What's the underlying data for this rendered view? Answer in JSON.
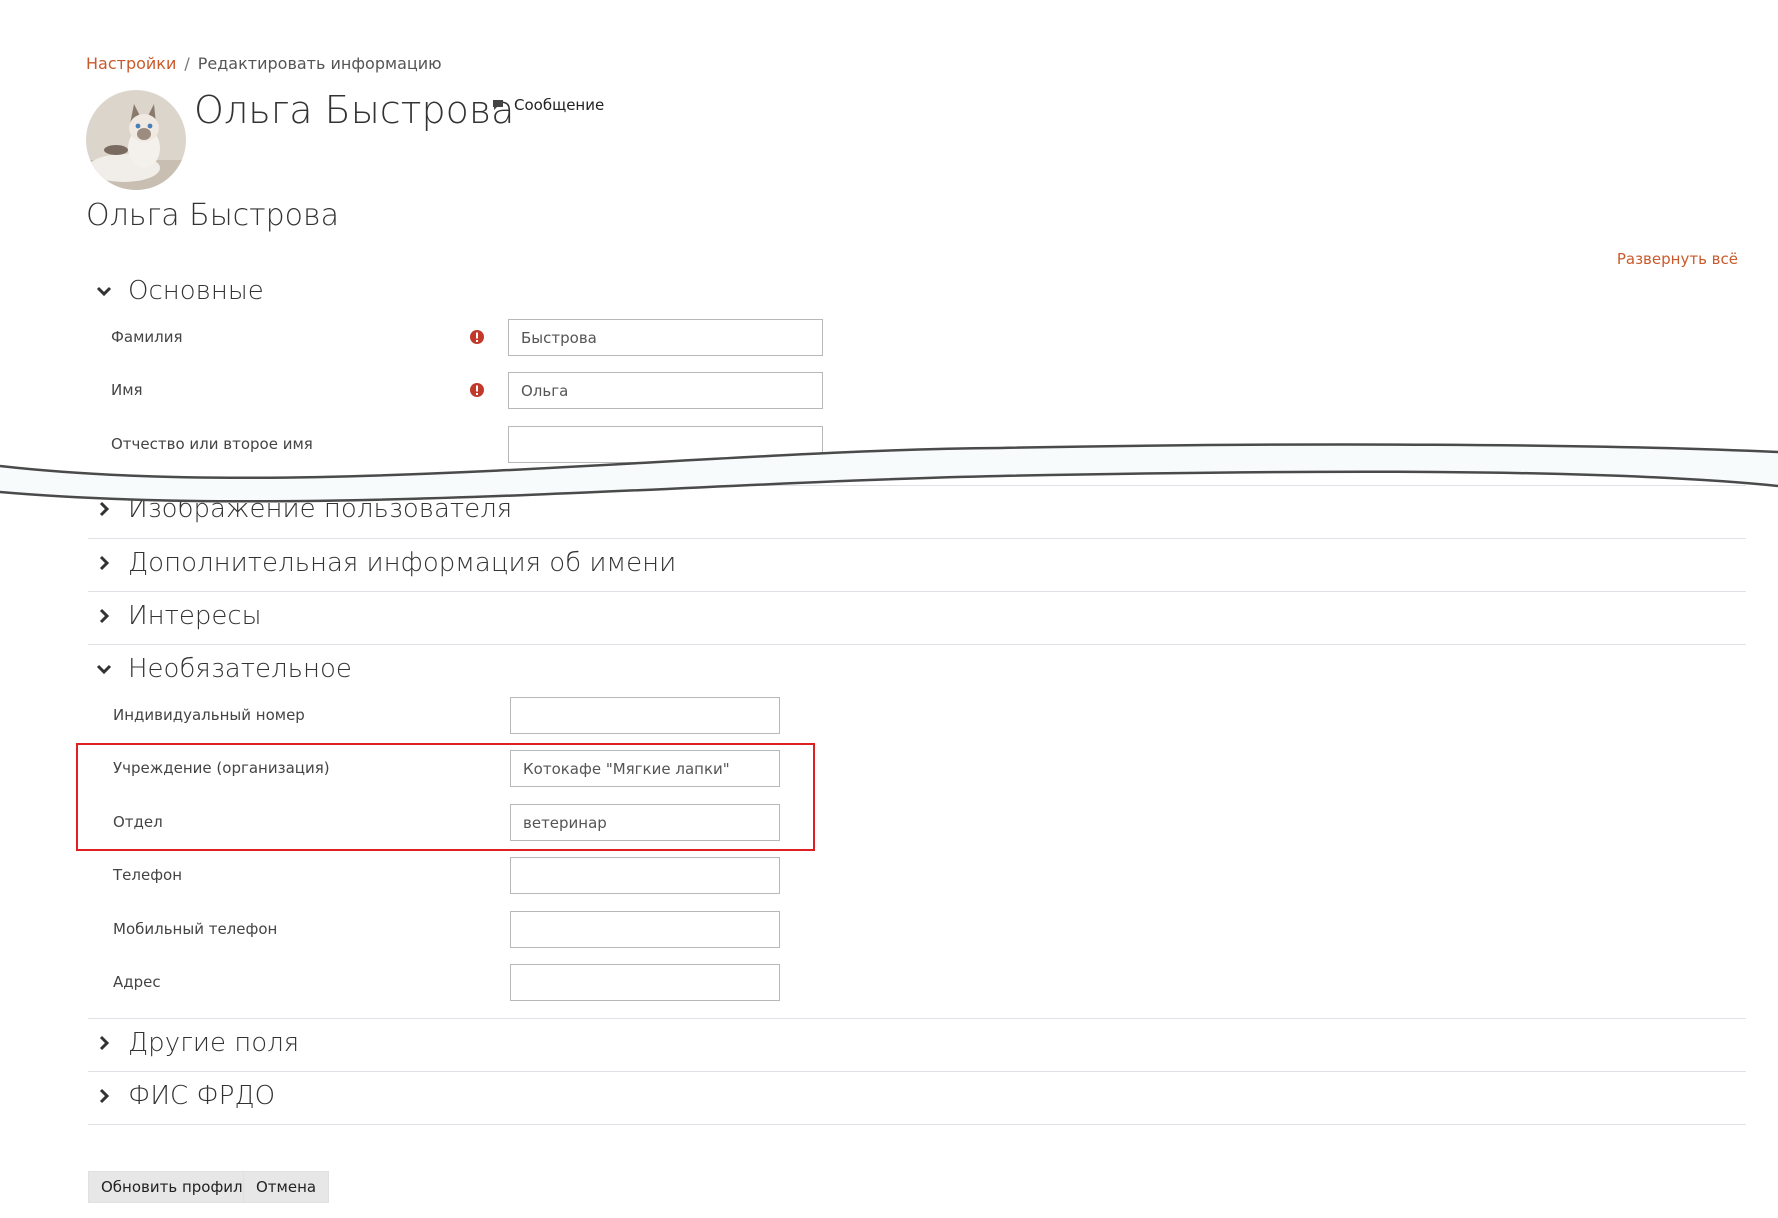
{
  "breadcrumb": {
    "parent": "Настройки",
    "separator": "/",
    "current": "Редактировать информацию"
  },
  "profile": {
    "name": "Ольга Быстрова",
    "message_label": "Сообщение"
  },
  "page_heading": "Ольга Быстрова",
  "expand_all": "Развернуть всё",
  "sections": {
    "basic": {
      "title": "Основные",
      "fields": {
        "lastname": {
          "label": "Фамилия",
          "value": "Быстрова"
        },
        "firstname": {
          "label": "Имя",
          "value": "Ольга"
        },
        "middlename": {
          "label": "Отчество или второе имя",
          "value": ""
        }
      }
    },
    "user_picture": {
      "title": "Изображение пользователя"
    },
    "name_info": {
      "title": "Дополнительная информация об имени"
    },
    "interests": {
      "title": "Интересы"
    },
    "optional": {
      "title": "Необязательное",
      "fields": {
        "idnumber": {
          "label": "Индивидуальный номер",
          "value": ""
        },
        "institution": {
          "label": "Учреждение (организация)",
          "value": "Котокафе \"Мягкие лапки\""
        },
        "department": {
          "label": "Отдел",
          "value": "ветеринар"
        },
        "phone": {
          "label": "Телефон",
          "value": ""
        },
        "mobile": {
          "label": "Мобильный телефон",
          "value": ""
        },
        "address": {
          "label": "Адрес",
          "value": ""
        }
      }
    },
    "other_fields": {
      "title": "Другие поля"
    },
    "fis_frdo": {
      "title": "ФИС ФРДО"
    }
  },
  "buttons": {
    "submit": "Обновить профиль",
    "cancel": "Отмена"
  },
  "colors": {
    "link": "#c95a2b",
    "required": "#c0392b",
    "highlight": "#e02020"
  }
}
